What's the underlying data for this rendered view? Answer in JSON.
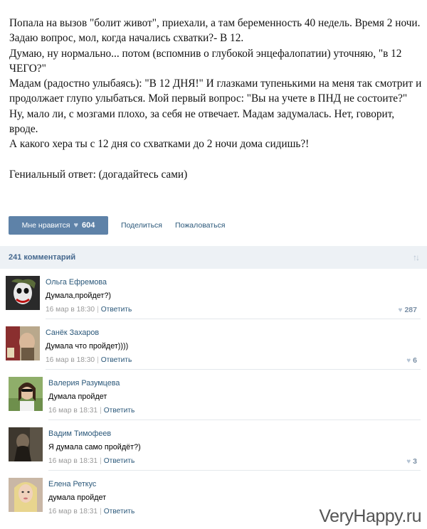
{
  "post": {
    "lines": [
      "Попала на вызов \"болит живот\", приехали, а там беременность 40 недель. Время 2 ночи. Задаю вопрос, мол, когда начались схватки?- В 12.",
      "Думаю, ну нормально... потом (вспомнив о глубокой энцефалопатии) уточняю, \"в 12 ЧЕГО?\"",
      "Мадам (радостно улыбаясь): \"В 12 ДНЯ!\" И глазками тупенькими на меня так смотрит и продолжает глупо улыбаться. Мой первый вопрос: \"Вы на учете в ПНД не состоите?\"",
      "Ну, мало ли, с мозгами плохо, за себя не отвечает. Мадам задумалась. Нет, говорит, вроде.",
      "А какого хера ты с 12 дня со схватками до 2 ночи дома сидишь?!"
    ],
    "answer": "Гениальный ответ: (догадайтесь сами)"
  },
  "actions": {
    "like_label": "Мне нравится",
    "like_count": "604",
    "share_label": "Поделиться",
    "report_label": "Пожаловаться"
  },
  "comments_header": {
    "title": "241 комментарий"
  },
  "comments": [
    {
      "name": "Ольга Ефремова",
      "text": "Думала,пройдет?)",
      "date": "16 мар в 18:30",
      "reply": "Ответить",
      "likes": "287"
    },
    {
      "name": "Санёк Захаров",
      "text": "Думала что пройдет))))",
      "date": "16 мар в 18:30",
      "reply": "Ответить",
      "likes": "6"
    },
    {
      "name": "Валерия Разумцева",
      "text": "Думала пройдет",
      "date": "16 мар в 18:31",
      "reply": "Ответить",
      "likes": ""
    },
    {
      "name": "Вадим Тимофеев",
      "text": "Я думала само пройдёт?)",
      "date": "16 мар в 18:31",
      "reply": "Ответить",
      "likes": "3"
    },
    {
      "name": "Елена Реткус",
      "text": "думала пройдет",
      "date": "16 мар в 18:31",
      "reply": "Ответить",
      "likes": ""
    }
  ],
  "watermark": "VeryHappy.ru"
}
